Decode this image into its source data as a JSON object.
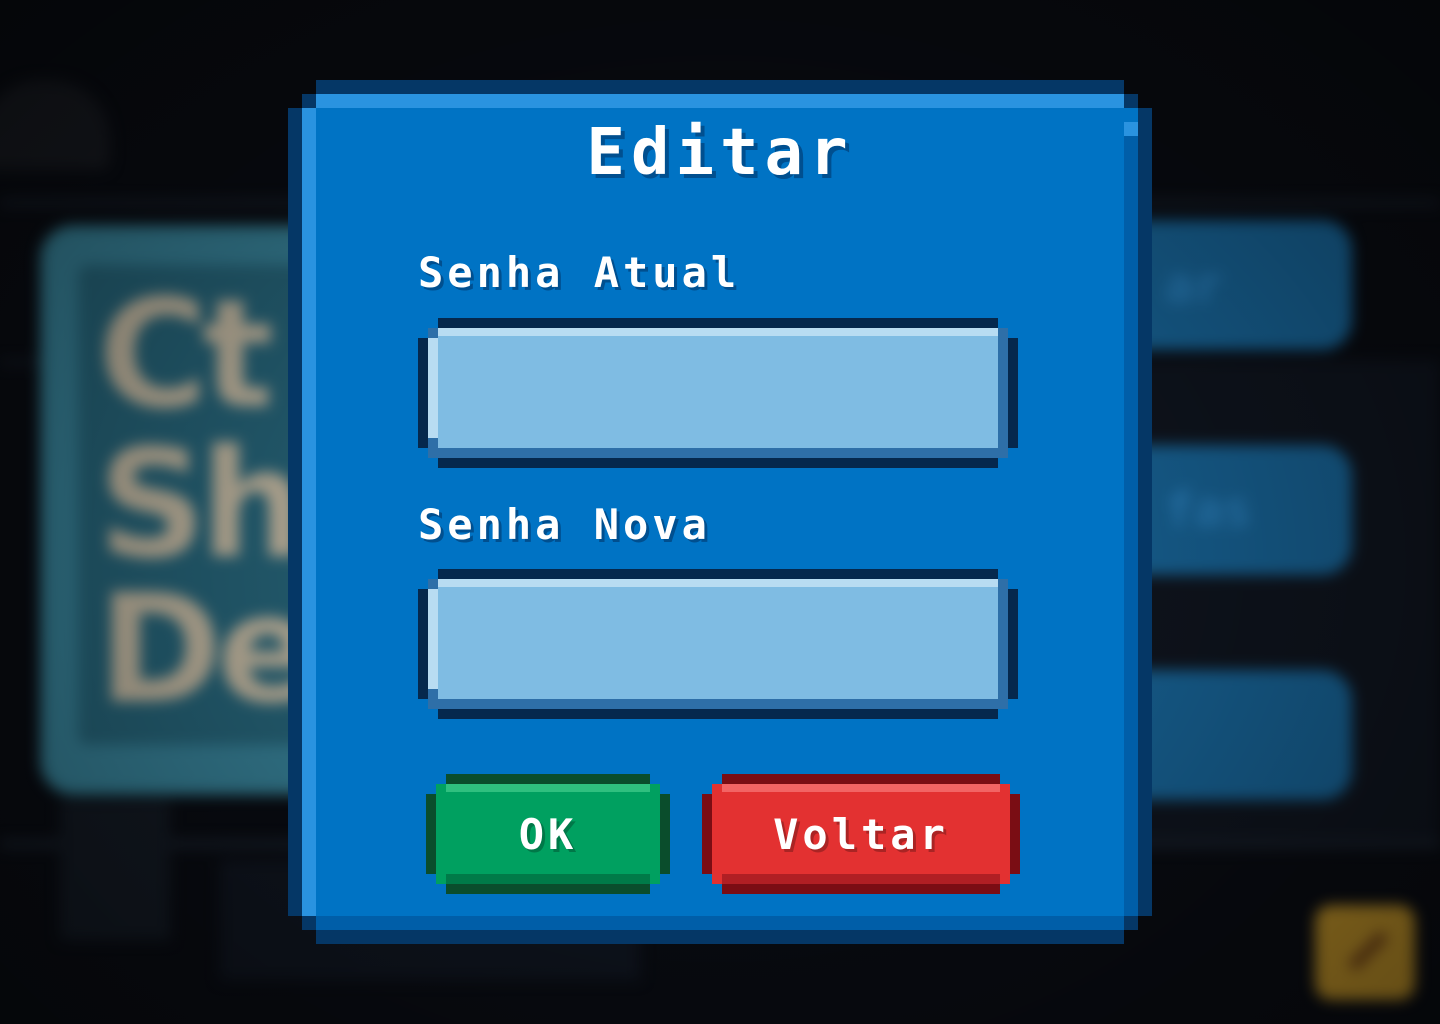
{
  "background": {
    "logo_lines": [
      "Ct",
      "Sh",
      "De"
    ],
    "menu_button_labels": [
      "ar",
      "fas",
      ""
    ]
  },
  "dialog": {
    "title": "Editar",
    "current_password": {
      "label": "Senha Atual",
      "value": "",
      "placeholder": ""
    },
    "new_password": {
      "label": "Senha Nova",
      "value": "",
      "placeholder": ""
    },
    "ok_label": "OK",
    "back_label": "Voltar"
  },
  "colors": {
    "dialog_fill": "#0073c4",
    "dialog_border": "#053766",
    "input_fill": "#7fbce3",
    "ok_button": "#00a060",
    "back_button": "#e33131",
    "backdrop": "#0a0d14"
  },
  "icons": {
    "bg_corner": "pencil-icon"
  }
}
